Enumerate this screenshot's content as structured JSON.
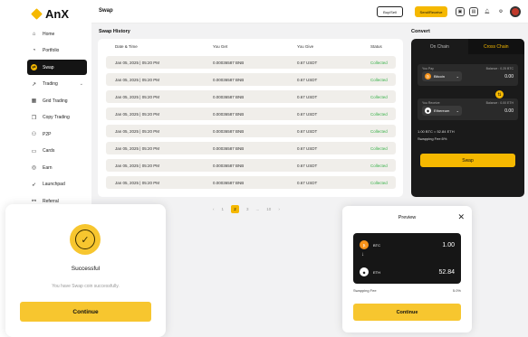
{
  "brand": {
    "name": "AnX",
    "accent": "#f5b800"
  },
  "sidebar": {
    "items": [
      {
        "label": "Home",
        "icon": "home-icon",
        "glyph": "⌂"
      },
      {
        "label": "Portfolio",
        "icon": "pie-icon",
        "glyph": "◔"
      },
      {
        "label": "Swap",
        "icon": "swap-icon",
        "glyph": "⇄",
        "active": true
      },
      {
        "label": "Trading",
        "icon": "chart-icon",
        "glyph": "↗",
        "chevron": true
      },
      {
        "label": "Grid Trading",
        "icon": "grid-icon",
        "glyph": "▦"
      },
      {
        "label": "Copy Trading",
        "icon": "copy-icon",
        "glyph": "❐"
      },
      {
        "label": "P2P",
        "icon": "people-icon",
        "glyph": "⚇"
      },
      {
        "label": "Cards",
        "icon": "card-icon",
        "glyph": "▭"
      },
      {
        "label": "Earn",
        "icon": "coin-icon",
        "glyph": "◎"
      },
      {
        "label": "Launchpad",
        "icon": "rocket-icon",
        "glyph": "➶"
      },
      {
        "label": "Referral",
        "icon": "referral-icon",
        "glyph": "⚯"
      }
    ]
  },
  "header": {
    "title": "Swap",
    "buysell": "Buy/Sell",
    "sendreceive": "Send/Receive"
  },
  "history": {
    "title": "Swap History",
    "columns": [
      "Date & Time",
      "You Get",
      "You Give",
      "Status"
    ],
    "rows": [
      [
        "Jan 05, 2025 | 05:20 PM",
        "0.00036587 BNB",
        "0.67 USDT",
        "Collected"
      ],
      [
        "Jan 05, 2025 | 05:20 PM",
        "0.00036587 BNB",
        "0.67 USDT",
        "Collected"
      ],
      [
        "Jan 05, 2025 | 05:20 PM",
        "0.00036587 BNB",
        "0.67 USDT",
        "Collected"
      ],
      [
        "Jan 05, 2025 | 05:20 PM",
        "0.00036587 BNB",
        "0.67 USDT",
        "Collected"
      ],
      [
        "Jan 05, 2025 | 05:20 PM",
        "0.00036587 BNB",
        "0.67 USDT",
        "Collected"
      ],
      [
        "Jan 05, 2025 | 05:20 PM",
        "0.00036587 BNB",
        "0.67 USDT",
        "Collected"
      ],
      [
        "Jan 05, 2025 | 05:20 PM",
        "0.00036587 BNB",
        "0.67 USDT",
        "Collected"
      ],
      [
        "Jan 05, 2025 | 05:20 PM",
        "0.00036587 BNB",
        "0.67 USDT",
        "Collected"
      ]
    ]
  },
  "pager": {
    "prev": "‹",
    "pages": [
      "1",
      "2",
      "3",
      "...",
      "10"
    ],
    "current": "2",
    "next": "›"
  },
  "convert": {
    "title": "Convert",
    "tab_onchain": "On Chain",
    "tab_crosschain": "Cross Chain",
    "from_label": "You Pay",
    "from_balance": "Balance : 0.25 BTC",
    "from_coin": "Bitcoin",
    "from_sub": "BTC",
    "from_amount": "0.00",
    "to_label": "You Receive",
    "to_balance": "Balance : 0.00 ETH",
    "to_coin": "Ethereum",
    "to_sub": "ETH",
    "to_amount": "0.00",
    "rate": "1.00 BTC = 52.84 ETH",
    "fee": "Swapping Fee:5%",
    "swap_label": "Swap"
  },
  "success": {
    "title": "Successful",
    "message": "You have Swap coin successfully.",
    "button": "Continue"
  },
  "preview": {
    "title": "Preview",
    "close": "✕",
    "from_sym": "BTC",
    "from_amt": "1.00",
    "to_sym": "ETH",
    "to_amt": "52.84",
    "fee_label": "Swapping Fee",
    "fee_value": "5.0%",
    "button": "Continue"
  }
}
